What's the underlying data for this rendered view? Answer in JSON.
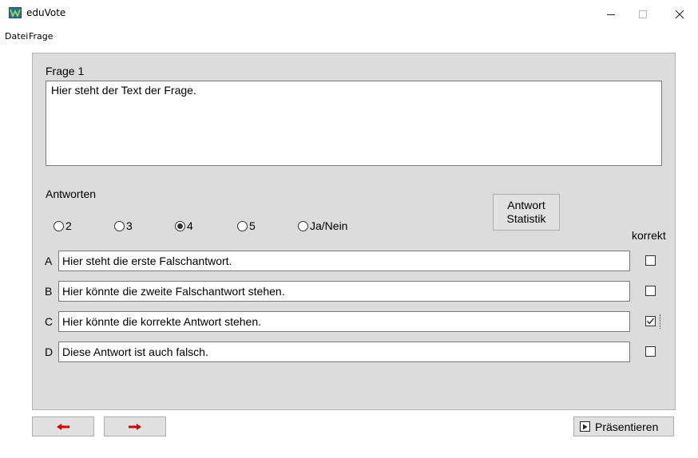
{
  "window": {
    "title": "eduVote",
    "controls": {
      "minimize": "—",
      "maximize": "☐",
      "close": "✕"
    }
  },
  "menu": {
    "items": [
      {
        "label": "Datei"
      },
      {
        "label": "Frage"
      }
    ]
  },
  "question": {
    "label": "Frage 1",
    "text": "Hier steht der Text der Frage."
  },
  "answers": {
    "label": "Antworten",
    "count_options": [
      {
        "label": "2",
        "selected": false
      },
      {
        "label": "3",
        "selected": false
      },
      {
        "label": "4",
        "selected": true
      },
      {
        "label": "5",
        "selected": false
      },
      {
        "label": "Ja/Nein",
        "selected": false
      }
    ],
    "stat_button": {
      "line1": "Antwort",
      "line2": "Statistik"
    },
    "correct_header": "korrekt",
    "rows": [
      {
        "letter": "A",
        "text": "Hier steht die erste Falschantwort.",
        "correct": false
      },
      {
        "letter": "B",
        "text": "Hier könnte die zweite Falschantwort stehen.",
        "correct": false
      },
      {
        "letter": "C",
        "text": "Hier könnte die korrekte Antwort stehen.",
        "correct": true
      },
      {
        "letter": "D",
        "text": "Diese Antwort ist auch falsch.",
        "correct": false
      }
    ]
  },
  "footer": {
    "prev_icon": "arrow-left-icon",
    "next_icon": "arrow-right-icon",
    "present_label": "Präsentieren",
    "arrow_color": "#d40000"
  }
}
